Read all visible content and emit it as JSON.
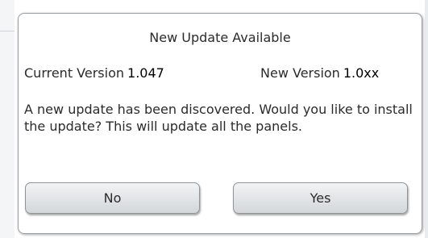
{
  "dialog": {
    "title": "New Update Available",
    "current_version_label": "Current Version",
    "current_version_value": "1.047",
    "new_version_label": "New Version",
    "new_version_value": "1.0xx",
    "message": "A new update has been discovered. Would you like to install the update? This will update all the panels.",
    "no_label": "No",
    "yes_label": "Yes"
  },
  "colors": {
    "dialog_border": "#9a9fa3",
    "button_gradient_top": "#f2f3f4",
    "button_gradient_bottom": "#d3d7da",
    "text": "#2b2b2b"
  }
}
